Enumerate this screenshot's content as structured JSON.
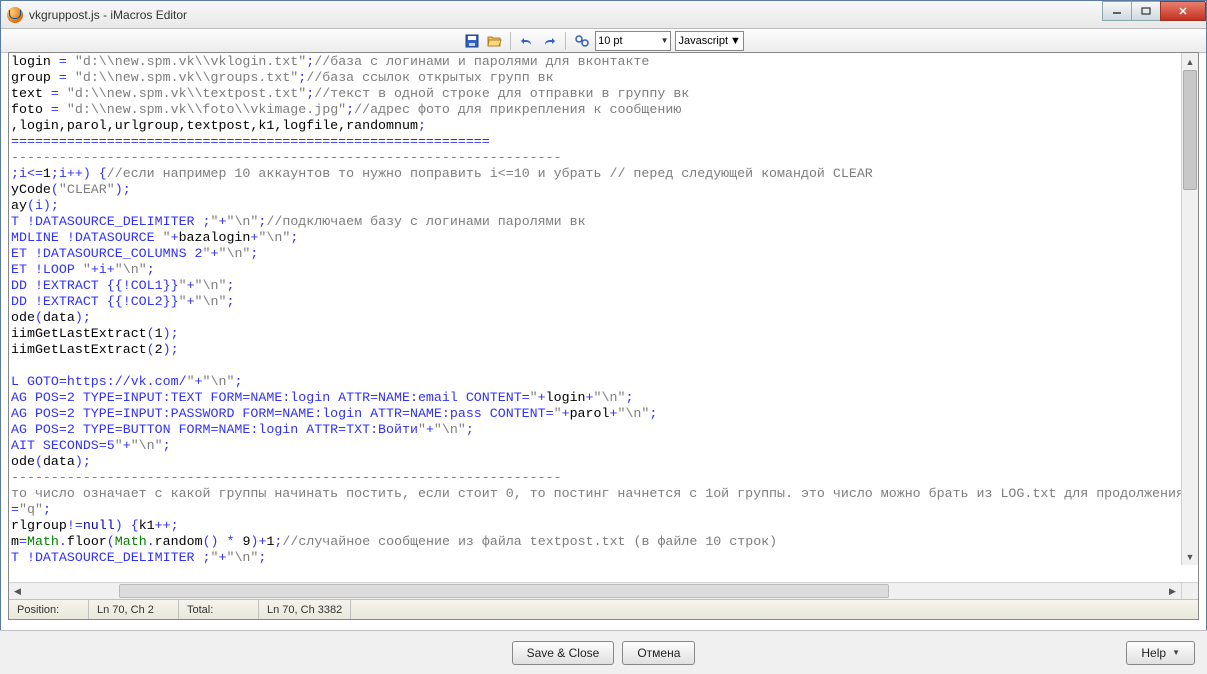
{
  "window": {
    "title": "vkgruppost.js - iMacros Editor"
  },
  "toolbar": {
    "font_size": "10 pt",
    "language": "Javascript",
    "icons": {
      "save": "save-icon",
      "open": "open-icon",
      "undo": "undo-icon",
      "redo": "redo-icon",
      "find": "find-icon"
    }
  },
  "status": {
    "position_label": "Position:",
    "position_value": "Ln 70, Ch 2",
    "total_label": "Total:",
    "total_value": "Ln 70, Ch 3382"
  },
  "footer": {
    "save_close": "Save & Close",
    "cancel": "Отмена",
    "help": "Help"
  },
  "code_lines": [
    {
      "t": [
        [
          "",
          "login "
        ],
        [
          "blue",
          "="
        ],
        [
          "",
          " "
        ],
        [
          "str",
          "\"d:\\\\new.spm.vk\\\\vklogin.txt\""
        ],
        [
          "blue",
          ";"
        ],
        [
          "cmt",
          "//база с логинами и паролями для вконтакте"
        ]
      ]
    },
    {
      "t": [
        [
          "",
          "group "
        ],
        [
          "blue",
          "="
        ],
        [
          "",
          " "
        ],
        [
          "str",
          "\"d:\\\\new.spm.vk\\\\groups.txt\""
        ],
        [
          "blue",
          ";"
        ],
        [
          "cmt",
          "//база ссылок открытых групп вк"
        ]
      ]
    },
    {
      "t": [
        [
          "",
          "text "
        ],
        [
          "blue",
          "="
        ],
        [
          "",
          " "
        ],
        [
          "str",
          "\"d:\\\\new.spm.vk\\\\textpost.txt\""
        ],
        [
          "blue",
          ";"
        ],
        [
          "cmt",
          "//текст в одной строке для отправки в группу вк"
        ]
      ]
    },
    {
      "t": [
        [
          "",
          "foto "
        ],
        [
          "blue",
          "="
        ],
        [
          "",
          " "
        ],
        [
          "str",
          "\"d:\\\\new.spm.vk\\\\foto\\\\vkimage.jpg\""
        ],
        [
          "blue",
          ";"
        ],
        [
          "cmt",
          "//адрес фото для прикрепления к сообщению"
        ]
      ]
    },
    {
      "t": [
        [
          ""
        ],
        [
          ""
        ],
        [
          ""
        ],
        [
          "",
          ",login,parol,urlgroup,textpost,k1,logfile,randomnum"
        ],
        [
          "blue",
          ";"
        ]
      ]
    },
    {
      "t": [
        [
          "blue",
          "============================================================"
        ]
      ]
    },
    {
      "t": [
        [
          "cmt",
          "---------------------------------------------------------------------"
        ]
      ]
    },
    {
      "t": [
        [
          "blue",
          ";i<="
        ],
        [
          "",
          "1"
        ],
        [
          "blue",
          ";i++) {"
        ],
        [
          "cmt",
          "//если например 10 аккаунтов то нужно поправить i<=10 и убрать // перед следующей командой CLEAR"
        ]
      ]
    },
    {
      "t": [
        [
          "",
          "yCode"
        ],
        [
          "blue",
          "("
        ],
        [
          "str",
          "\"CLEAR\""
        ],
        [
          "blue",
          ");"
        ]
      ]
    },
    {
      "t": [
        [
          "",
          "ay"
        ],
        [
          "blue",
          "(i);"
        ]
      ]
    },
    {
      "t": [
        [
          "blue",
          "T !DATASOURCE_DELIMITER ;"
        ],
        [
          "str",
          "\""
        ],
        [
          "blue",
          "+"
        ],
        [
          "str",
          "\"\\n\""
        ],
        [
          "blue",
          ";"
        ],
        [
          "cmt",
          "//подключаем базу с логинами паролями вк"
        ]
      ]
    },
    {
      "t": [
        [
          "blue",
          "MDLINE !DATASOURCE "
        ],
        [
          "str",
          "\""
        ],
        [
          "blue",
          "+"
        ],
        [
          "",
          "bazalogin"
        ],
        [
          "blue",
          "+"
        ],
        [
          "str",
          "\"\\n\""
        ],
        [
          "blue",
          ";"
        ]
      ]
    },
    {
      "t": [
        [
          "blue",
          "ET !DATASOURCE_COLUMNS 2"
        ],
        [
          "str",
          "\""
        ],
        [
          "blue",
          "+"
        ],
        [
          "str",
          "\"\\n\""
        ],
        [
          "blue",
          ";"
        ]
      ]
    },
    {
      "t": [
        [
          "blue",
          "ET !LOOP "
        ],
        [
          "str",
          "\""
        ],
        [
          "blue",
          "+i+"
        ],
        [
          "str",
          "\"\\n\""
        ],
        [
          "blue",
          ";"
        ]
      ]
    },
    {
      "t": [
        [
          "blue",
          "DD !EXTRACT {{!COL1}}"
        ],
        [
          "str",
          "\""
        ],
        [
          "blue",
          "+"
        ],
        [
          "str",
          "\"\\n\""
        ],
        [
          "blue",
          ";"
        ]
      ]
    },
    {
      "t": [
        [
          "blue",
          "DD !EXTRACT {{!COL2}}"
        ],
        [
          "str",
          "\""
        ],
        [
          "blue",
          "+"
        ],
        [
          "str",
          "\"\\n\""
        ],
        [
          "blue",
          ";"
        ]
      ]
    },
    {
      "t": [
        [
          "",
          "ode"
        ],
        [
          "blue",
          "("
        ],
        [
          "",
          "data"
        ],
        [
          "blue",
          ");"
        ]
      ]
    },
    {
      "t": [
        [
          "",
          "iimGetLastExtract"
        ],
        [
          "blue",
          "("
        ],
        [
          "",
          "1"
        ],
        [
          "blue",
          ");"
        ]
      ]
    },
    {
      "t": [
        [
          "",
          "iimGetLastExtract"
        ],
        [
          "blue",
          "("
        ],
        [
          "",
          "2"
        ],
        [
          "blue",
          ");"
        ]
      ]
    },
    {
      "t": [
        [
          "",
          ""
        ]
      ]
    },
    {
      "t": [
        [
          "blue",
          "L GOTO=https://vk.com/"
        ],
        [
          "str",
          "\""
        ],
        [
          "blue",
          "+"
        ],
        [
          "str",
          "\"\\n\""
        ],
        [
          "blue",
          ";"
        ]
      ]
    },
    {
      "t": [
        [
          "blue",
          "AG POS=2 TYPE=INPUT:TEXT FORM=NAME:login ATTR=NAME:email CONTENT="
        ],
        [
          "str",
          "\""
        ],
        [
          "blue",
          "+"
        ],
        [
          "",
          "login"
        ],
        [
          "blue",
          "+"
        ],
        [
          "str",
          "\"\\n\""
        ],
        [
          "blue",
          ";"
        ]
      ]
    },
    {
      "t": [
        [
          "blue",
          "AG POS=2 TYPE=INPUT:PASSWORD FORM=NAME:login ATTR=NAME:pass CONTENT="
        ],
        [
          "str",
          "\""
        ],
        [
          "blue",
          "+"
        ],
        [
          "",
          "parol"
        ],
        [
          "blue",
          "+"
        ],
        [
          "str",
          "\"\\n\""
        ],
        [
          "blue",
          ";"
        ]
      ]
    },
    {
      "t": [
        [
          "blue",
          "AG POS=2 TYPE=BUTTON FORM=NAME:login ATTR=TXT:Войти"
        ],
        [
          "str",
          "\""
        ],
        [
          "blue",
          "+"
        ],
        [
          "str",
          "\"\\n\""
        ],
        [
          "blue",
          ";"
        ]
      ]
    },
    {
      "t": [
        [
          "blue",
          "AIT SECONDS=5"
        ],
        [
          "str",
          "\""
        ],
        [
          "blue",
          "+"
        ],
        [
          "str",
          "\"\\n\""
        ],
        [
          "blue",
          ";"
        ]
      ]
    },
    {
      "t": [
        [
          "",
          "ode"
        ],
        [
          "blue",
          "("
        ],
        [
          "",
          "data"
        ],
        [
          "blue",
          ");"
        ]
      ]
    },
    {
      "t": [
        [
          "cmt",
          "---------------------------------------------------------------------"
        ]
      ]
    },
    {
      "t": [
        [
          "cmt",
          "то число означает с какой группы начинать постить, если стоит 0, то постинг начнется с 1ой группы. это число можно брать из LOG.txt для продолжения"
        ]
      ]
    },
    {
      "t": [
        [
          "blue",
          "="
        ],
        [
          "str",
          "\"q\""
        ],
        [
          "blue",
          ";"
        ]
      ]
    },
    {
      "t": [
        [
          "",
          "rlgroup"
        ],
        [
          "blue",
          "!="
        ],
        [
          "kw",
          "null"
        ],
        [
          "blue",
          ") {"
        ],
        [
          "",
          "k1"
        ],
        [
          "blue",
          "++;"
        ]
      ]
    },
    {
      "t": [
        [
          "",
          "m"
        ],
        [
          "blue",
          "="
        ],
        [
          "green",
          "Math"
        ],
        [
          "blue",
          "."
        ],
        [
          "",
          "floor"
        ],
        [
          "blue",
          "("
        ],
        [
          "green",
          "Math"
        ],
        [
          "blue",
          "."
        ],
        [
          "",
          "random"
        ],
        [
          "blue",
          "()"
        ],
        [
          "",
          " "
        ],
        [
          "blue",
          "*"
        ],
        [
          "",
          " 9"
        ],
        [
          "blue",
          ")+"
        ],
        [
          "",
          "1"
        ],
        [
          "blue",
          ";"
        ],
        [
          "cmt",
          "//случайное сообщение из файла textpost.txt (в файле 10 строк)"
        ]
      ]
    },
    {
      "t": [
        [
          "blue",
          "T !DATASOURCE_DELIMITER ;"
        ],
        [
          "str",
          "\""
        ],
        [
          "blue",
          "+"
        ],
        [
          "str",
          "\"\\n\""
        ],
        [
          "blue",
          ";"
        ]
      ]
    }
  ]
}
